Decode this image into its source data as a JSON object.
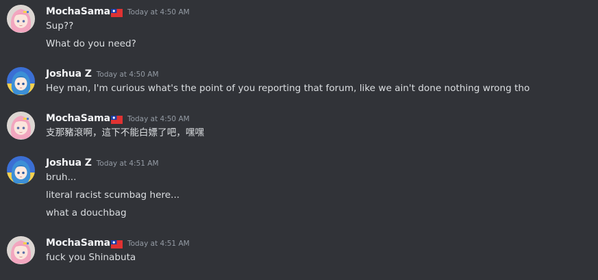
{
  "messages": [
    {
      "author": "MochaSama",
      "author_flag": "taiwan-flag",
      "timestamp": "Today at 4:50 AM",
      "avatar": "pink-haired-anime-avatar",
      "lines": [
        "Sup??",
        "What do you need?"
      ]
    },
    {
      "author": "Joshua Z",
      "timestamp": "Today at 4:50 AM",
      "avatar": "blue-haired-anime-avatar",
      "lines": [
        "Hey man, I'm curious what's the point of you reporting that forum, like we ain't done nothing wrong tho"
      ]
    },
    {
      "author": "MochaSama",
      "author_flag": "taiwan-flag",
      "timestamp": "Today at 4:50 AM",
      "avatar": "pink-haired-anime-avatar",
      "lines": [
        "支那豬滾啊，這下不能白嫖了吧，嘿嘿"
      ]
    },
    {
      "author": "Joshua Z",
      "timestamp": "Today at 4:51 AM",
      "avatar": "blue-haired-anime-avatar",
      "lines": [
        "bruh...",
        "literal racist scumbag here...",
        "what a douchbag"
      ]
    },
    {
      "author": "MochaSama",
      "author_flag": "taiwan-flag",
      "timestamp": "Today at 4:51 AM",
      "avatar": "pink-haired-anime-avatar",
      "lines": [
        "fuck you Shinabuta"
      ]
    }
  ],
  "colors": {
    "background": "#313338",
    "username": "#f2f3f5",
    "message_text": "#dbdee1",
    "timestamp": "#949ba4"
  }
}
